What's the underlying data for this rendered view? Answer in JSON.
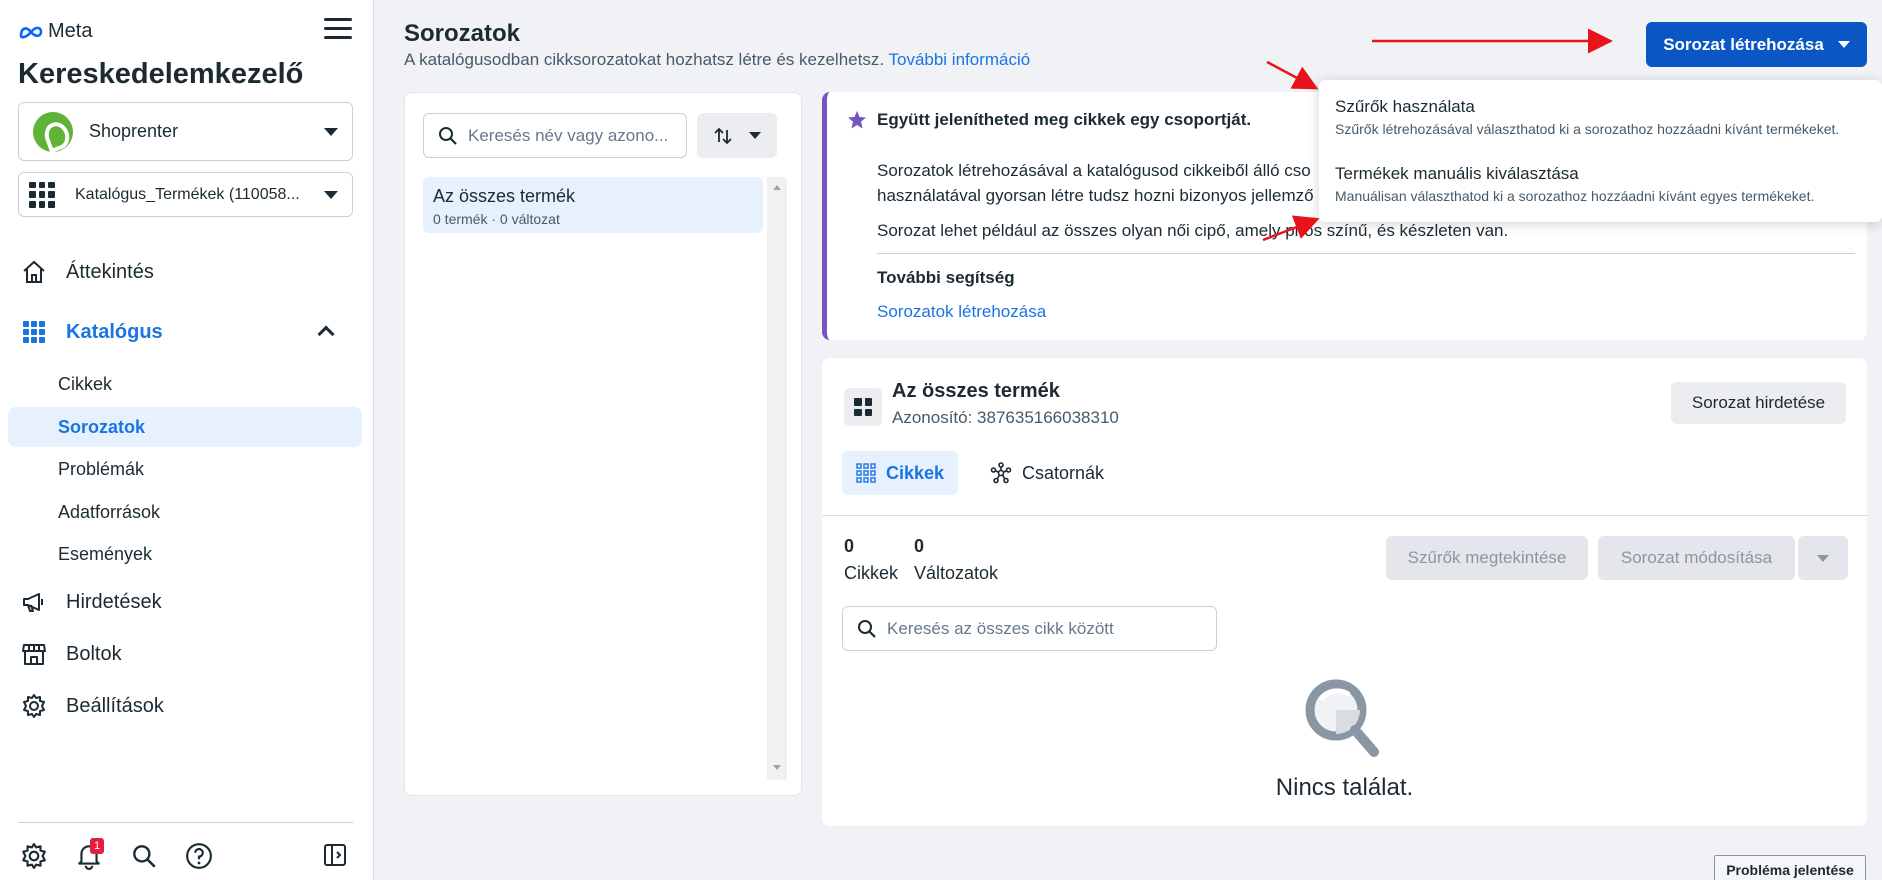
{
  "sidebar": {
    "logo": "Meta",
    "app_title": "Kereskedelemkezelő",
    "business": "Shoprenter",
    "catalog": "Katalógus_Termékek (110058...",
    "nav": {
      "overview": "Áttekintés",
      "catalog": "Katalógus",
      "sub": {
        "items": "Cikkek",
        "sets": "Sorozatok",
        "issues": "Problémák",
        "sources": "Adatforrások",
        "events": "Események"
      },
      "ads": "Hirdetések",
      "shops": "Boltok",
      "settings": "Beállítások"
    },
    "notification_count": "1"
  },
  "header": {
    "title": "Sorozatok",
    "subtitle": "A katalógusodban cikksorozatokat hozhatsz létre és kezelhetsz.",
    "more_link": "További információ",
    "create_button": "Sorozat létrehozása"
  },
  "set_list": {
    "search_placeholder": "Keresés név vagy azono...",
    "items": [
      {
        "name": "Az összes termék",
        "meta": "0 termék · 0 változat"
      }
    ]
  },
  "info": {
    "heading": "Együtt jelenítheted meg cikkek egy csoportját.",
    "para1_line1": "Sorozatok létrehozásával a katalógusod cikkeiből álló cso",
    "para1_line2": "használatával gyorsan létre tudsz hozni bizonyos jellemző",
    "para2": "Sorozat lehet például az összes olyan női cipő, amely piros színű, és készleten van.",
    "help_title": "További segítség",
    "help_link": "Sorozatok létrehozása"
  },
  "detail": {
    "title": "Az összes termék",
    "id_label": "Azonosító: 387635166038310",
    "ad_button": "Sorozat hirdetése",
    "tabs": {
      "items": "Cikkek",
      "channels": "Csatornák"
    },
    "items_count": "0",
    "items_label": "Cikkek",
    "variants_count": "0",
    "variants_label": "Változatok",
    "view_filters": "Szűrők megtekintése",
    "edit_set": "Sorozat módosítása",
    "search_placeholder": "Keresés az összes cikk között",
    "empty": "Nincs találat."
  },
  "dropdown": {
    "options": [
      {
        "title": "Szűrők használata",
        "desc": "Szűrők létrehozásával választhatod ki a sorozathoz hozzáadni kívánt termékeket."
      },
      {
        "title": "Termékek manuális kiválasztása",
        "desc": "Manuálisan választhatod ki a sorozathoz hozzáadni kívánt egyes termékeket."
      }
    ]
  },
  "report_button": "Probléma jelentése",
  "colors": {
    "accent": "#1b74e4",
    "primary_button": "#0a56c5",
    "info_border": "#7654c1",
    "annotation_arrow": "#e8141c"
  }
}
